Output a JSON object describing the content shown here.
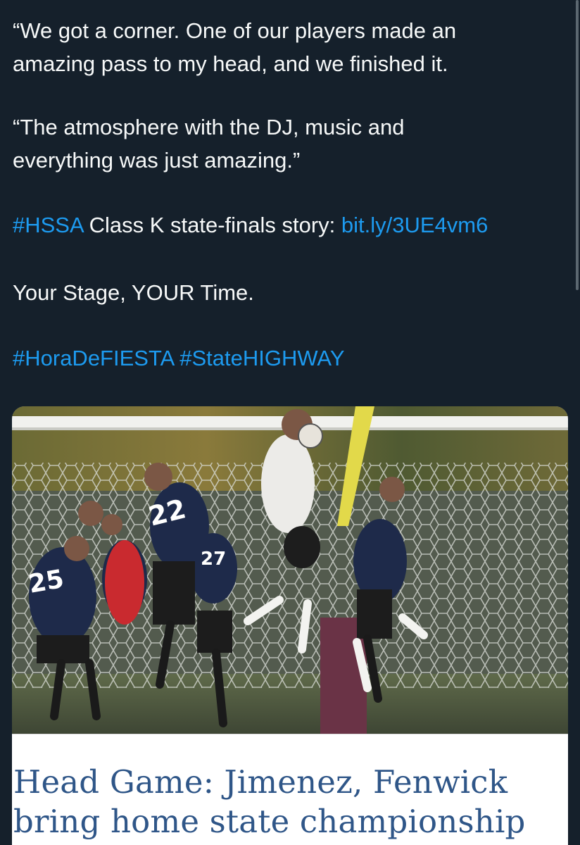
{
  "tweet": {
    "quote_line_1": "“We got a corner. One of our players made an",
    "quote_line_2": "amazing pass to my head, and we finished it.",
    "quote2_line_1": "“The atmosphere with the DJ, music and",
    "quote2_line_2": "everything was just amazing.”",
    "story_hashtag": "#HSSA",
    "story_text": " Class K state-finals story: ",
    "story_link": "bit.ly/3UE4vm6",
    "slogan": "Your Stage, YOUR Time.",
    "hashtag_1": "#HoraDeFIESTA",
    "hashtag_2": "#StateHIGHWAY"
  },
  "card": {
    "image_icon": "soccer-header-photo",
    "headline_line_1": "Head Game: Jimenez, Fenwick",
    "headline_line_2": "bring home state championship"
  },
  "colors": {
    "background": "#15202b",
    "text": "#f7f9f9",
    "link": "#1d9bf0",
    "headline": "#2f5688"
  }
}
